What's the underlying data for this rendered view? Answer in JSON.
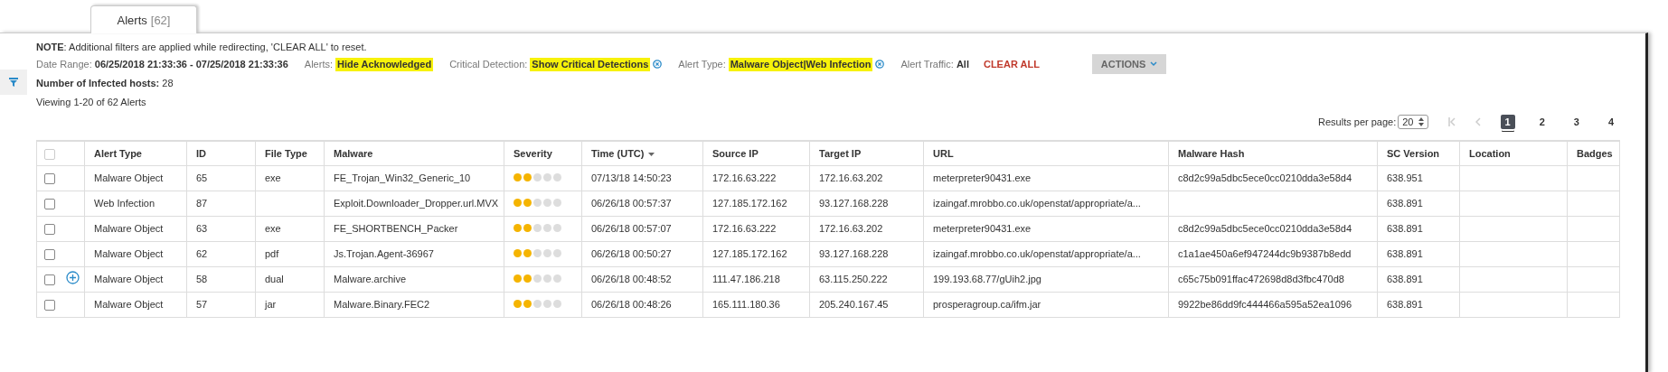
{
  "tabs": [
    {
      "label": "Alerts",
      "count": "[62]",
      "selected": true
    }
  ],
  "note": {
    "label": "NOTE",
    "text": ": Additional filters are applied while redirecting, 'CLEAR ALL' to reset."
  },
  "filters": [
    {
      "label": "Date Range:",
      "value": "06/25/2018 21:33:36 - 07/25/2018 21:33:36",
      "highlighted": false,
      "removable": false
    },
    {
      "label": "Alerts:",
      "value": "Hide Acknowledged",
      "highlighted": true,
      "removable": false
    },
    {
      "label": "Critical Detection:",
      "value": "Show Critical Detections",
      "highlighted": true,
      "removable": true
    },
    {
      "label": "Alert Type:",
      "value": "Malware Object|Web Infection",
      "highlighted": true,
      "removable": true
    },
    {
      "label": "Alert Traffic:",
      "value": "All",
      "highlighted": false,
      "removable": false
    }
  ],
  "clear_all": "CLEAR ALL",
  "actions_button": "ACTIONS",
  "infected_hosts": {
    "label": "Number of Infected hosts:",
    "value": "28"
  },
  "viewing": "Viewing 1-20 of 62 Alerts",
  "pagination": {
    "label": "Results per page:",
    "per_page": "20",
    "pages": [
      {
        "label": "1",
        "selected": true
      },
      {
        "label": "2",
        "selected": false
      },
      {
        "label": "3",
        "selected": false
      },
      {
        "label": "4",
        "selected": false
      }
    ]
  },
  "table": {
    "select_all": {
      "checked": false,
      "disabled": true
    },
    "columns": [
      "Alert Type",
      "ID",
      "File Type",
      "Malware",
      "Severity",
      "Time (UTC)",
      "Source IP",
      "Target IP",
      "URL",
      "Malware Hash",
      "SC Version",
      "Location",
      "Badges"
    ],
    "rows": [
      {
        "checked": false,
        "expandable": false,
        "alert_type": "Malware Object",
        "id": "65",
        "file_type": "exe",
        "malware": "FE_Trojan_Win32_Generic_10",
        "stars": 2,
        "time": "07/13/18 14:50:23",
        "source_ip": "172.16.63.222",
        "target_ip": "172.16.63.202",
        "url": "meterpreter90431.exe",
        "hash": "c8d2c99a5dbc5ece0cc0210dda3e58d4",
        "sc_version": "638.951"
      },
      {
        "checked": false,
        "expandable": false,
        "alert_type": "Web Infection",
        "id": "87",
        "file_type": "",
        "malware": "Exploit.Downloader_Dropper.url.MVX",
        "stars": 2,
        "time": "06/26/18 00:57:37",
        "source_ip": "127.185.172.162",
        "target_ip": "93.127.168.228",
        "url": "izaingaf.mrobbo.co.uk/openstat/appropriate/a...",
        "hash": "",
        "sc_version": "638.891"
      },
      {
        "checked": false,
        "expandable": false,
        "alert_type": "Malware Object",
        "id": "63",
        "file_type": "exe",
        "malware": "FE_SHORTBENCH_Packer",
        "stars": 2,
        "time": "06/26/18 00:57:07",
        "source_ip": "172.16.63.222",
        "target_ip": "172.16.63.202",
        "url": "meterpreter90431.exe",
        "hash": "c8d2c99a5dbc5ece0cc0210dda3e58d4",
        "sc_version": "638.891"
      },
      {
        "checked": false,
        "expandable": false,
        "alert_type": "Malware Object",
        "id": "62",
        "file_type": "pdf",
        "malware": "Js.Trojan.Agent-36967",
        "stars": 2,
        "time": "06/26/18 00:50:27",
        "source_ip": "127.185.172.162",
        "target_ip": "93.127.168.228",
        "url": "izaingaf.mrobbo.co.uk/openstat/appropriate/a...",
        "hash": "c1a1ae450a6ef947244dc9b9387b8edd",
        "sc_version": "638.891"
      },
      {
        "checked": false,
        "expandable": true,
        "alert_type": "Malware Object",
        "id": "58",
        "file_type": "dual",
        "malware": "Malware.archive",
        "stars": 2,
        "time": "06/26/18 00:48:52",
        "source_ip": "111.47.186.218",
        "target_ip": "63.115.250.222",
        "url": "199.193.68.77/gUih2.jpg",
        "hash": "c65c75b091ffac472698d8d3fbc470d8",
        "sc_version": "638.891"
      },
      {
        "checked": false,
        "expandable": false,
        "alert_type": "Malware Object",
        "id": "57",
        "file_type": "jar",
        "malware": "Malware.Binary.FEC2",
        "stars": 2,
        "time": "06/26/18 00:48:26",
        "source_ip": "165.111.180.36",
        "target_ip": "205.240.167.45",
        "url": "prosperagroup.ca/ifm.jar",
        "hash": "9922be86dd9fc444466a595a52ea1096",
        "sc_version": "638.891"
      }
    ]
  }
}
